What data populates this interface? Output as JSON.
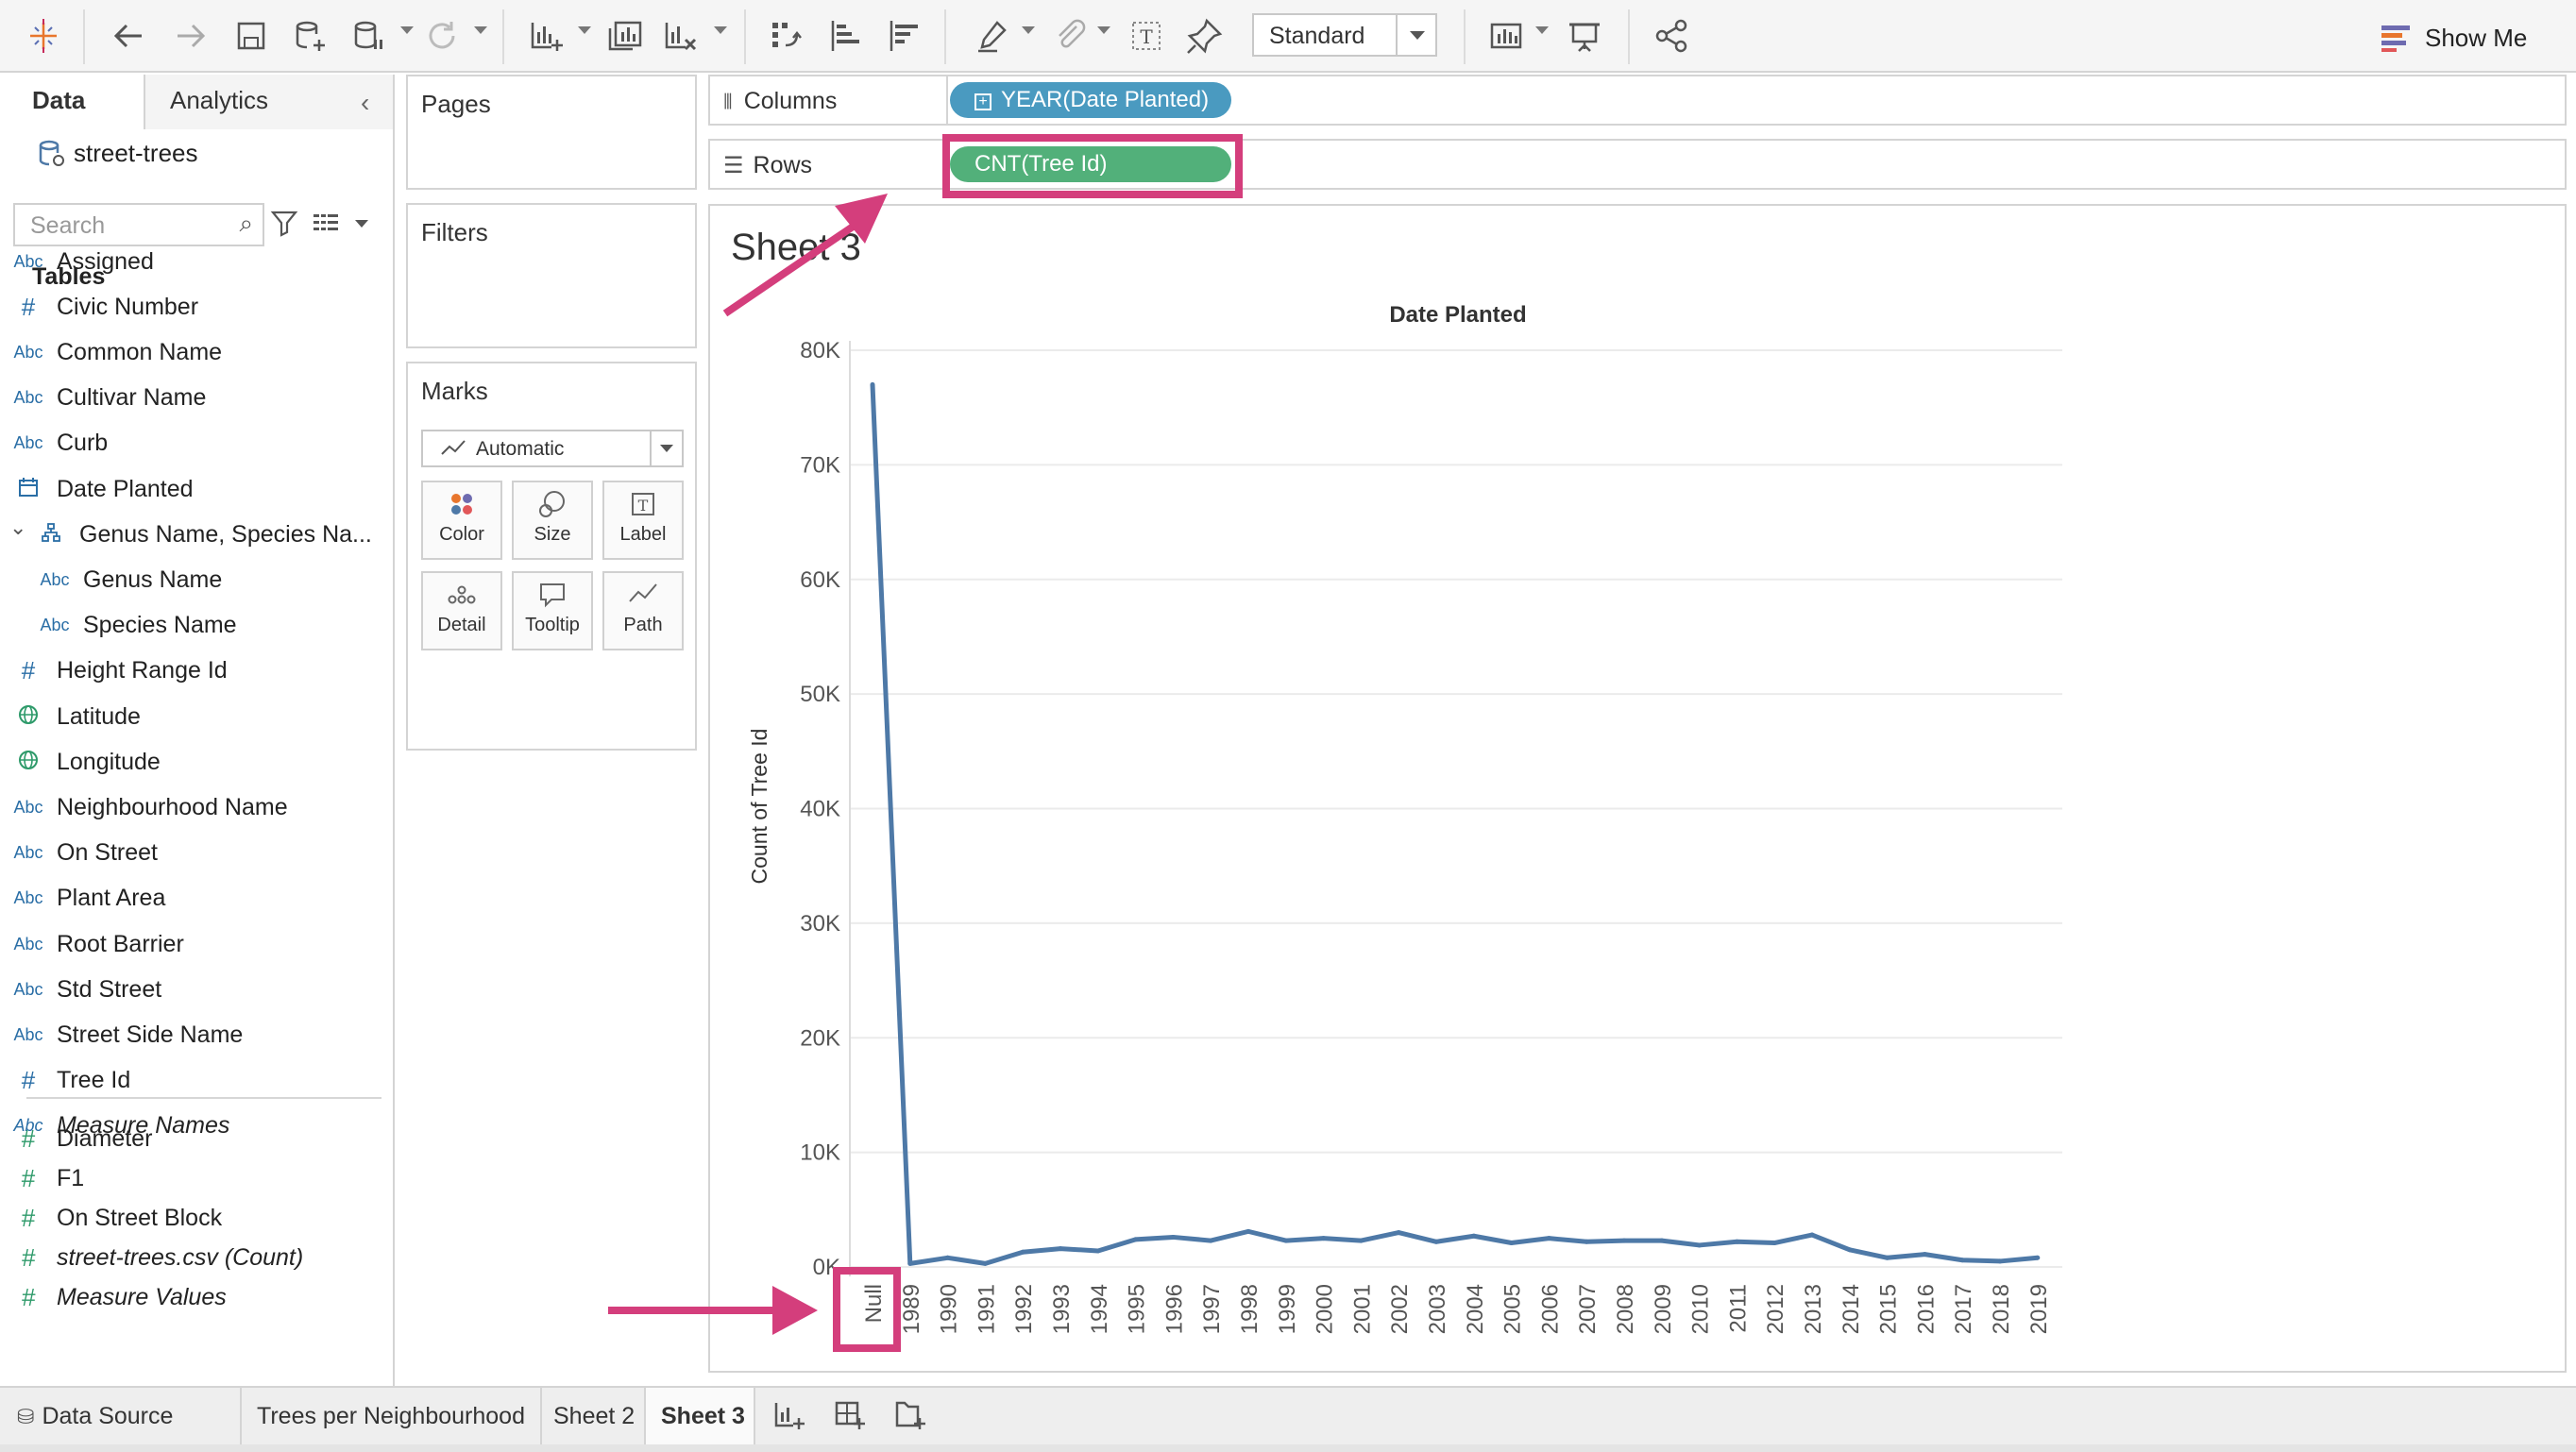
{
  "toolbar": {
    "fit_value": "Standard",
    "show_me_label": "Show Me",
    "icons": [
      "tableau-logo-icon",
      "undo-icon",
      "redo-icon",
      "save-icon",
      "new-datasource-icon",
      "pause-update-icon",
      "refresh-icon",
      "new-worksheet-icon",
      "duplicate-sheet-icon",
      "clear-sheet-icon",
      "swap-rows-columns-icon",
      "sort-ascending-icon",
      "sort-descending-icon",
      "highlight-icon",
      "group-members-icon",
      "show-mark-labels-icon",
      "fix-axes-icon",
      "show-cards-icon",
      "presentation-mode-icon",
      "share-icon"
    ]
  },
  "data_pane": {
    "tabs": [
      "Data",
      "Analytics"
    ],
    "active_tab": "Data",
    "datasource": "street-trees",
    "search_placeholder": "Search",
    "tables_header": "Tables",
    "fields": [
      {
        "name": "Assigned",
        "type": "Abc"
      },
      {
        "name": "Civic Number",
        "type": "#"
      },
      {
        "name": "Common Name",
        "type": "Abc"
      },
      {
        "name": "Cultivar Name",
        "type": "Abc"
      },
      {
        "name": "Curb",
        "type": "Abc"
      },
      {
        "name": "Date Planted",
        "type": "date"
      },
      {
        "name": "Genus Name, Species Na...",
        "type": "hierarchy"
      },
      {
        "name": "Genus Name",
        "type": "Abc"
      },
      {
        "name": "Species Name",
        "type": "Abc"
      },
      {
        "name": "Height Range Id",
        "type": "#"
      },
      {
        "name": "Latitude",
        "type": "geo"
      },
      {
        "name": "Longitude",
        "type": "geo"
      },
      {
        "name": "Neighbourhood Name",
        "type": "Abc"
      },
      {
        "name": "On Street",
        "type": "Abc"
      },
      {
        "name": "Plant Area",
        "type": "Abc"
      },
      {
        "name": "Root Barrier",
        "type": "Abc"
      },
      {
        "name": "Std Street",
        "type": "Abc"
      },
      {
        "name": "Street Side Name",
        "type": "Abc"
      },
      {
        "name": "Tree Id",
        "type": "#"
      },
      {
        "name": "Measure Names",
        "type": "Abc"
      }
    ],
    "measures": [
      {
        "name": "Diameter",
        "type": "#"
      },
      {
        "name": "F1",
        "type": "#"
      },
      {
        "name": "On Street Block",
        "type": "#"
      },
      {
        "name": "street-trees.csv (Count)",
        "type": "#"
      },
      {
        "name": "Measure Values",
        "type": "#"
      }
    ]
  },
  "cards": {
    "pages": "Pages",
    "filters": "Filters",
    "marks": "Marks",
    "mark_type": "Automatic",
    "mark_buttons": [
      "Color",
      "Size",
      "Label",
      "Detail",
      "Tooltip",
      "Path"
    ]
  },
  "shelves": {
    "columns_label": "Columns",
    "columns_pill": "YEAR(Date Planted)",
    "rows_label": "Rows",
    "rows_pill": "CNT(Tree Id)"
  },
  "sheet_title": "Sheet 3",
  "colors": {
    "line": "#4e79a7",
    "pill_dimension": "#4a9ac0",
    "pill_measure": "#52b07a",
    "annotation": "#d43e7c"
  },
  "chart_data": {
    "type": "line",
    "title": "Date Planted",
    "ylabel": "Count of Tree Id",
    "xlabel": "",
    "ylim": [
      0,
      80000
    ],
    "yticks": [
      "0K",
      "10K",
      "20K",
      "30K",
      "40K",
      "50K",
      "60K",
      "70K",
      "80K"
    ],
    "ytick_values": [
      0,
      10000,
      20000,
      30000,
      40000,
      50000,
      60000,
      70000,
      80000
    ],
    "grid": true,
    "categories": [
      "Null",
      "1989",
      "1990",
      "1991",
      "1992",
      "1993",
      "1994",
      "1995",
      "1996",
      "1997",
      "1998",
      "1999",
      "2000",
      "2001",
      "2002",
      "2003",
      "2004",
      "2005",
      "2006",
      "2007",
      "2008",
      "2009",
      "2010",
      "2011",
      "2012",
      "2013",
      "2014",
      "2015",
      "2016",
      "2017",
      "2018",
      "2019"
    ],
    "values": [
      77000,
      300,
      800,
      300,
      1300,
      1600,
      1400,
      2400,
      2600,
      2300,
      3100,
      2300,
      2500,
      2300,
      3000,
      2200,
      2700,
      2100,
      2500,
      2200,
      2300,
      2300,
      1900,
      2200,
      2100,
      2800,
      1500,
      800,
      1100,
      600,
      500,
      800
    ]
  },
  "bottom_tabs": [
    "Data Source",
    "Trees per Neighbourhood",
    "Sheet 2",
    "Sheet 3"
  ],
  "active_sheet": "Sheet 3"
}
